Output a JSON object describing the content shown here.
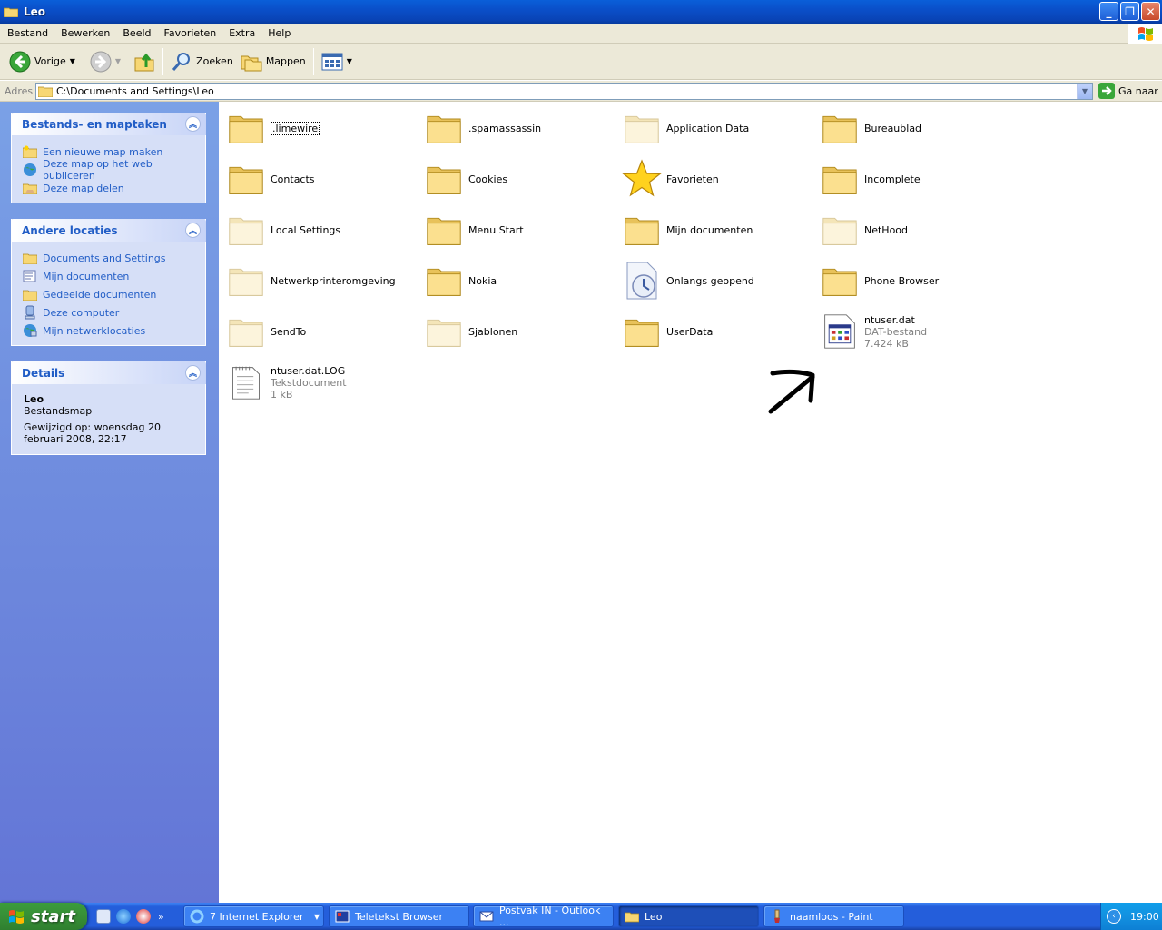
{
  "window": {
    "title": "Leo"
  },
  "menu": [
    "Bestand",
    "Bewerken",
    "Beeld",
    "Favorieten",
    "Extra",
    "Help"
  ],
  "toolbar": {
    "back": "Vorige",
    "search": "Zoeken",
    "folders": "Mappen"
  },
  "address": {
    "label": "Adres",
    "value": "C:\\Documents and Settings\\Leo",
    "go": "Ga naar"
  },
  "sidebar": {
    "tasks": {
      "title": "Bestands- en maptaken",
      "items": [
        "Een nieuwe map maken",
        "Deze map op het web publiceren",
        "Deze map delen"
      ]
    },
    "other": {
      "title": "Andere locaties",
      "items": [
        "Documents and Settings",
        "Mijn documenten",
        "Gedeelde documenten",
        "Deze computer",
        "Mijn netwerklocaties"
      ]
    },
    "details": {
      "title": "Details",
      "name": "Leo",
      "type": "Bestandsmap",
      "modified": "Gewijzigd op: woensdag 20 februari 2008, 22:17"
    }
  },
  "items": [
    {
      "name": ".limewire",
      "icon": "folder-icon"
    },
    {
      "name": ".spamassassin",
      "icon": "folder-icon"
    },
    {
      "name": "Application Data",
      "icon": "folder-hidden-icon"
    },
    {
      "name": "Bureaublad",
      "icon": "folder-icon"
    },
    {
      "name": "Contacts",
      "icon": "folder-icon"
    },
    {
      "name": "Cookies",
      "icon": "folder-icon"
    },
    {
      "name": "Favorieten",
      "icon": "star-icon"
    },
    {
      "name": "Incomplete",
      "icon": "folder-icon"
    },
    {
      "name": "Local Settings",
      "icon": "folder-hidden-icon"
    },
    {
      "name": "Menu Start",
      "icon": "folder-icon"
    },
    {
      "name": "Mijn documenten",
      "icon": "folder-icon"
    },
    {
      "name": "NetHood",
      "icon": "folder-hidden-icon"
    },
    {
      "name": "Netwerkprinteromgeving",
      "icon": "folder-hidden-icon"
    },
    {
      "name": "Nokia",
      "icon": "folder-icon"
    },
    {
      "name": "Onlangs geopend",
      "icon": "recent-icon"
    },
    {
      "name": "Phone Browser",
      "icon": "folder-icon"
    },
    {
      "name": "SendTo",
      "icon": "folder-hidden-icon"
    },
    {
      "name": "Sjablonen",
      "icon": "folder-hidden-icon"
    },
    {
      "name": "UserData",
      "icon": "folder-icon"
    },
    {
      "name": "ntuser.dat",
      "type": "DAT-bestand",
      "size": "7.424 kB",
      "icon": "dat-file-icon"
    },
    {
      "name": "ntuser.dat.LOG",
      "type": "Tekstdocument",
      "size": "1 kB",
      "icon": "text-file-icon"
    }
  ],
  "taskbar": {
    "start": "start",
    "buttons": [
      "7 Internet Explorer",
      "Teletekst Browser",
      "Postvak IN - Outlook ...",
      "Leo",
      "naamloos - Paint"
    ],
    "clock": "19:00"
  }
}
